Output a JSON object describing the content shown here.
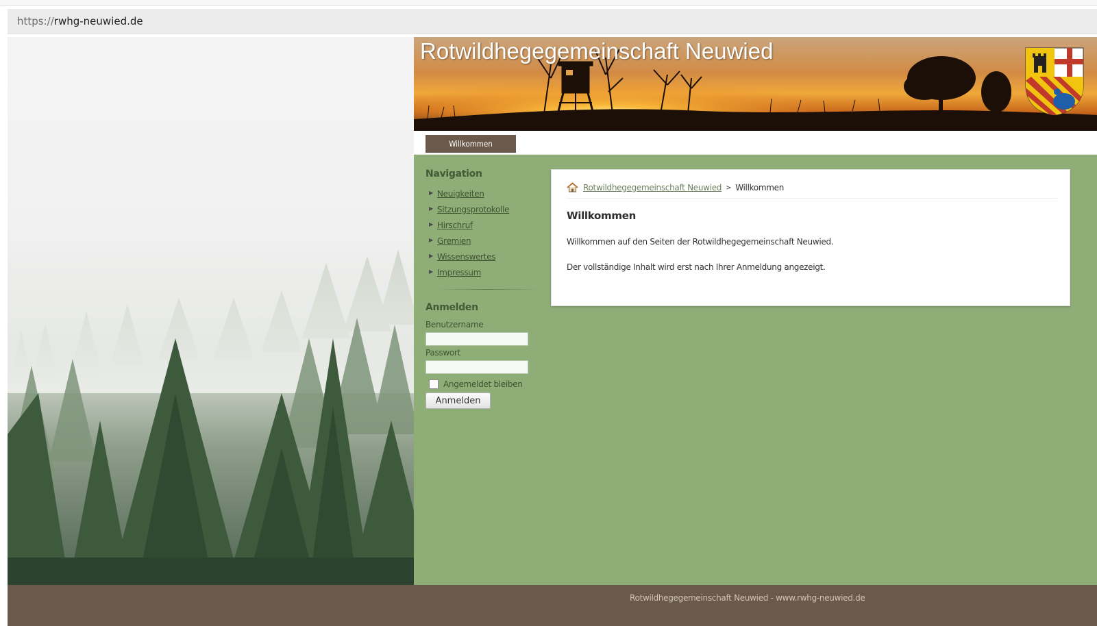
{
  "browser": {
    "url_scheme": "https://",
    "url_host": "rwhg-neuwied.de"
  },
  "site": {
    "title": "Rotwildhegegemeinschaft Neuwied",
    "top_nav": [
      {
        "label": "Willkommen",
        "active": true
      }
    ],
    "colors": {
      "content_background": "#8fad77",
      "nav_tab": "#6b5a4b",
      "footer": "#6b5a4b",
      "link": "#3f5331"
    }
  },
  "sidebar": {
    "nav_heading": "Navigation",
    "nav_items": [
      {
        "label": "Neuigkeiten"
      },
      {
        "label": "Sitzungsprotokolle"
      },
      {
        "label": "Hirschruf"
      },
      {
        "label": "Gremien"
      },
      {
        "label": "Wissenswertes"
      },
      {
        "label": "Impressum"
      }
    ],
    "login": {
      "heading": "Anmelden",
      "username_label": "Benutzername",
      "username_value": "",
      "password_label": "Passwort",
      "password_value": "",
      "remember_label": "Angemeldet bleiben",
      "remember_checked": false,
      "submit_label": "Anmelden"
    }
  },
  "content": {
    "breadcrumb": {
      "home_icon": "home-icon",
      "home_label": "Rotwildhegegemeinschaft Neuwied",
      "separator": ">",
      "current": "Willkommen"
    },
    "title": "Willkommen",
    "paragraphs": [
      "Willkommen auf den Seiten der Rotwildhegegemeinschaft Neuwied.",
      "Der vollständige Inhalt wird erst nach Ihrer Anmeldung angezeigt."
    ]
  },
  "footer": {
    "text": "Rotwildhegegemeinschaft Neuwied - www.rwhg-neuwied.de"
  }
}
